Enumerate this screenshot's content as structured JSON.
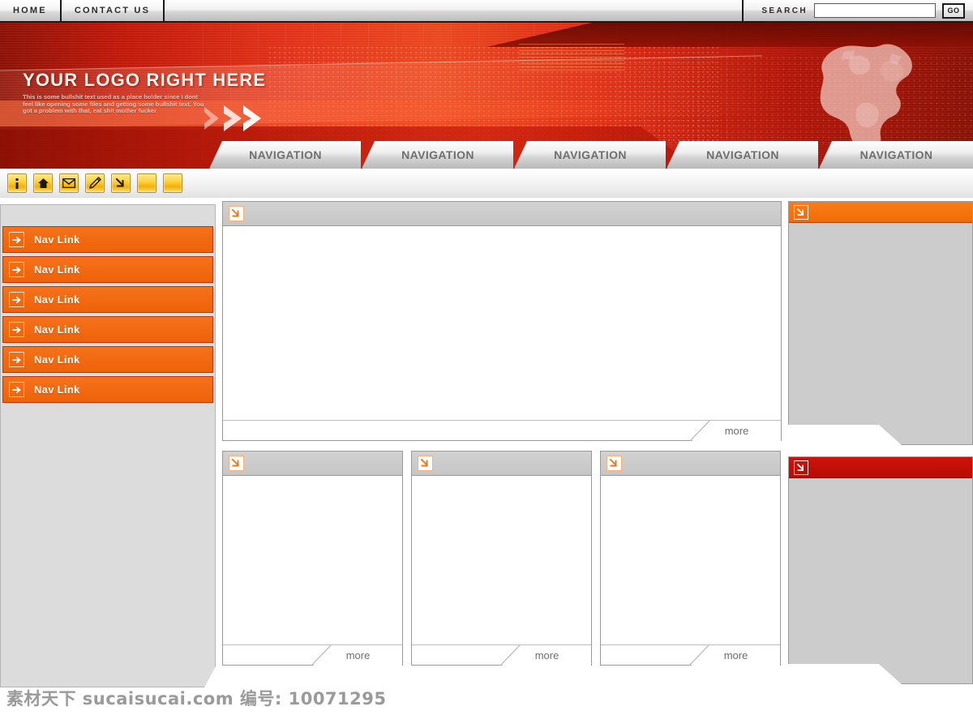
{
  "topbar": {
    "menu": [
      {
        "label": "HOME",
        "name": "home"
      },
      {
        "label": "CONTACT US",
        "name": "contact-us"
      }
    ],
    "search": {
      "label": "SEARCH",
      "value": "",
      "placeholder": "",
      "button_label": "GO"
    }
  },
  "banner": {
    "logo_title": "YOUR LOGO RIGHT HERE",
    "logo_subtext": "This is some bullshit text used as a place holder since I dont feel like opening some files and getting some bullshit text. You got a problem with that, eat shit mother fucker",
    "nav_tabs": [
      {
        "label": "NAVIGATION"
      },
      {
        "label": "NAVIGATION"
      },
      {
        "label": "NAVIGATION"
      },
      {
        "label": "NAVIGATION"
      },
      {
        "label": "NAVIGATION"
      }
    ],
    "globe_alt": "world-map-globe"
  },
  "toolbar": {
    "icons": [
      {
        "name": "info-icon"
      },
      {
        "name": "home-icon"
      },
      {
        "name": "mail-icon"
      },
      {
        "name": "edit-pencil-icon"
      },
      {
        "name": "arrow-down-right-icon"
      },
      {
        "name": "blank-icon"
      },
      {
        "name": "blank-icon"
      }
    ]
  },
  "sidebar": {
    "links": [
      {
        "label": "Nav Link"
      },
      {
        "label": "Nav Link"
      },
      {
        "label": "Nav Link"
      },
      {
        "label": "Nav Link"
      },
      {
        "label": "Nav Link"
      },
      {
        "label": "Nav Link"
      }
    ]
  },
  "main": {
    "feature_panel": {
      "title": "",
      "body": "",
      "more_label": "more"
    },
    "columns": [
      {
        "title": "",
        "body": "",
        "more_label": "more"
      },
      {
        "title": "",
        "body": "",
        "more_label": "more"
      },
      {
        "title": "",
        "body": "",
        "more_label": "more"
      }
    ]
  },
  "right_sidebar": {
    "panels": [
      {
        "accent": "#f06c06",
        "title": "",
        "body": ""
      },
      {
        "accent": "#b70d05",
        "title": "",
        "body": ""
      }
    ]
  },
  "footer": {
    "watermark": "素材天下 sucaisucai.com  编号: 10071295"
  },
  "colors": {
    "orange": "#f06c06",
    "red": "#b70d05",
    "banner_red": "#e8341a",
    "panel_gray": "#cccccc",
    "sidebar_gray": "#dcdcdc",
    "icon_gold": "#f5ae08"
  }
}
